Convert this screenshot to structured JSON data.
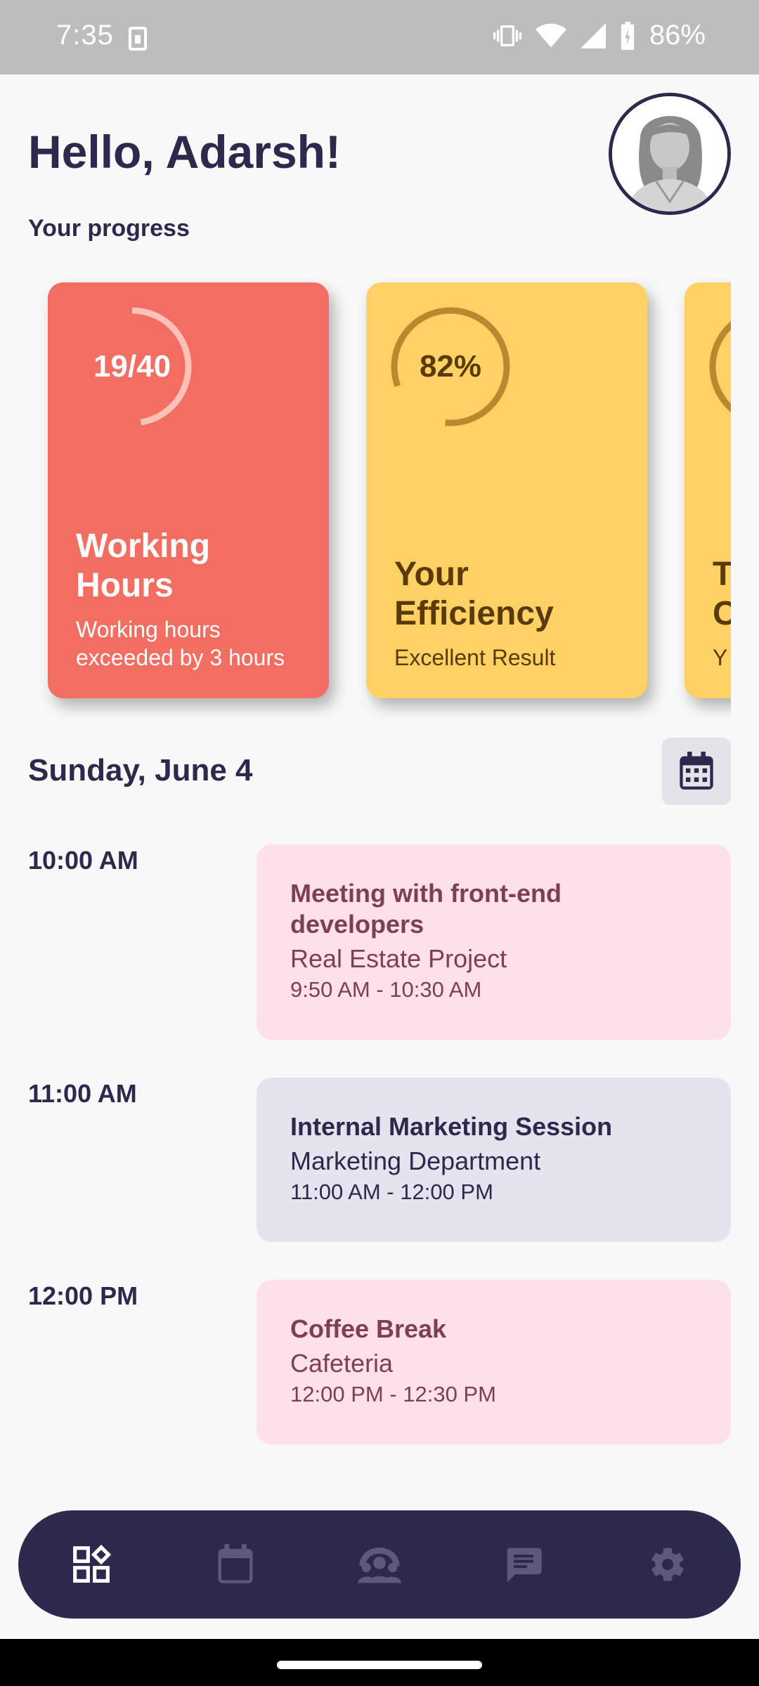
{
  "status_bar": {
    "time": "7:35",
    "battery": "86%"
  },
  "header": {
    "greeting": "Hello, Adarsh!",
    "progress_label": "Your progress"
  },
  "cards": [
    {
      "ring_text": "19/40",
      "title_line1": "Working",
      "title_line2": "Hours",
      "sub_line1": "Working hours",
      "sub_line2": "exceeded by 3 hours",
      "progress": 0.475,
      "color": "#f36e62"
    },
    {
      "ring_text": "82%",
      "title_line1": "Your",
      "title_line2": "Efficiency",
      "sub_line1": "Excellent Result",
      "progress": 0.82,
      "color": "#fed165"
    },
    {
      "title_line1": "T",
      "title_line2": "C",
      "sub_line1": "Y",
      "color": "#fed165"
    }
  ],
  "schedule": {
    "date": "Sunday, June 4",
    "events": [
      {
        "slot": "10:00 AM",
        "title": "Meeting with front-end developers",
        "subtitle": "Real Estate Project",
        "time": "9:50 AM - 10:30 AM"
      },
      {
        "slot": "11:00 AM",
        "title": "Internal Marketing Session",
        "subtitle": "Marketing Department",
        "time": "11:00 AM - 12:00 PM"
      },
      {
        "slot": "12:00 PM",
        "title": "Coffee Break",
        "subtitle": "Cafeteria",
        "time": "12:00 PM - 12:30 PM"
      }
    ]
  },
  "nav": {
    "items": [
      "dashboard-icon",
      "calendar-icon",
      "team-icon",
      "messages-icon",
      "settings-icon"
    ],
    "active_color": "#ffffff",
    "inactive_color": "#5b5a7a"
  }
}
